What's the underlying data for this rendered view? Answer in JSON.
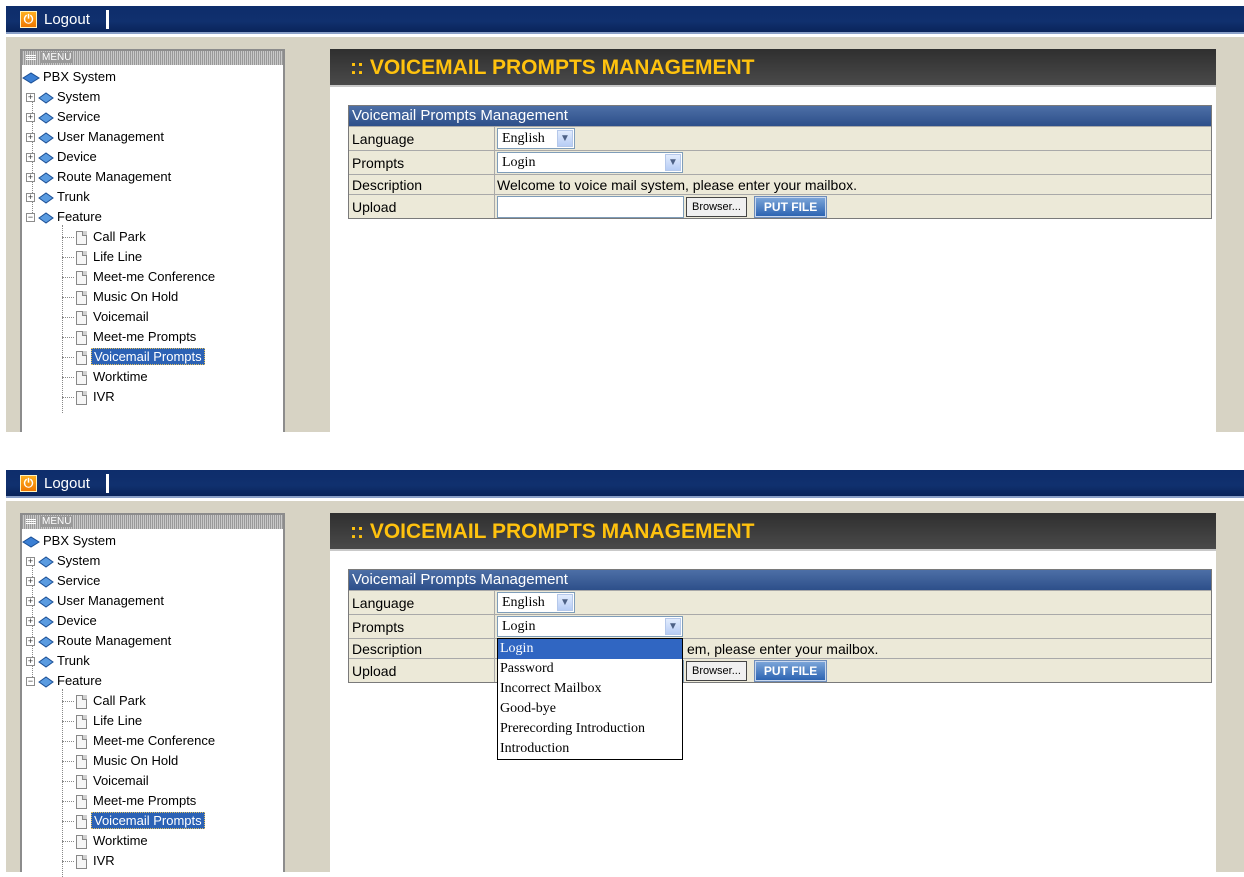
{
  "header": {
    "logout_label": "Logout"
  },
  "menu": {
    "title": "MENU",
    "root": "PBX System",
    "groups": [
      "System",
      "Service",
      "User Management",
      "Device",
      "Route Management",
      "Trunk",
      "Feature"
    ],
    "feature_items": [
      "Call Park",
      "Life Line",
      "Meet-me Conference",
      "Music On Hold",
      "Voicemail",
      "Meet-me Prompts",
      "Voicemail Prompts",
      "Worktime",
      "IVR"
    ],
    "selected": "Voicemail Prompts"
  },
  "page": {
    "title": ":: VOICEMAIL PROMPTS MANAGEMENT"
  },
  "form": {
    "header": "Voicemail Prompts Management",
    "language_label": "Language",
    "language_value": "English",
    "prompts_label": "Prompts",
    "prompts_value": "Login",
    "description_label": "Description",
    "description_value": "Welcome to voice mail system, please enter your mailbox.",
    "description_partial": "em, please enter your mailbox.",
    "upload_label": "Upload",
    "upload_value": "",
    "browse_label": "Browser...",
    "put_file_label": "PUT FILE"
  },
  "prompts_options": [
    "Login",
    "Password",
    "Incorrect Mailbox",
    "Good-bye",
    "Prerecording Introduction",
    "Introduction"
  ],
  "prompts_active": "Login"
}
